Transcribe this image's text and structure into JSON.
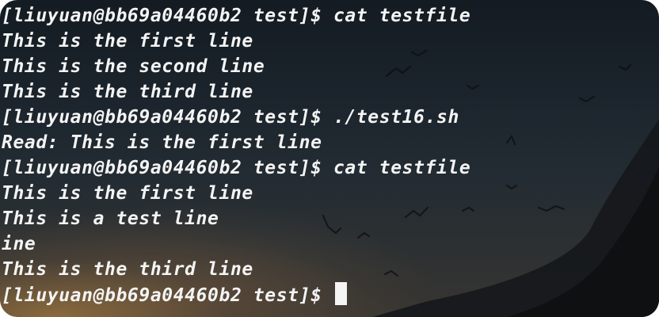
{
  "terminal": {
    "lines": [
      "[liuyuan@bb69a04460b2 test]$ cat testfile",
      "This is the first line",
      "This is the second line",
      "This is the third line",
      "[liuyuan@bb69a04460b2 test]$ ./test16.sh",
      "Read: This is the first line",
      "[liuyuan@bb69a04460b2 test]$ cat testfile",
      "This is the first line",
      "This is a test line",
      "ine",
      "This is the third line"
    ],
    "prompt": "[liuyuan@bb69a04460b2 test]$ ",
    "text_color": "#f4f4f4",
    "cursor_color": "#f4f4f4"
  }
}
